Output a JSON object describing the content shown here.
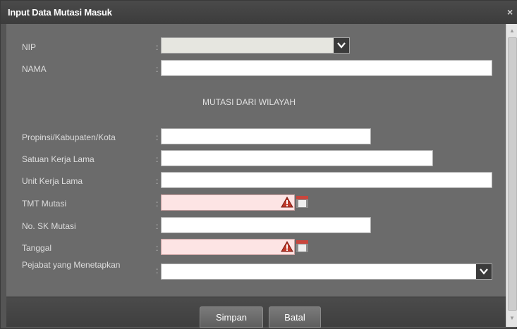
{
  "dialog": {
    "title": "Input Data Mutasi Masuk",
    "close_glyph": "×"
  },
  "form": {
    "colon": ":",
    "nip": {
      "label": "NIP",
      "value": ""
    },
    "nama": {
      "label": "NAMA",
      "value": ""
    },
    "section_title": "MUTASI DARI WILAYAH",
    "propinsi": {
      "label": "Propinsi/Kabupaten/Kota",
      "value": ""
    },
    "satuan_kerja": {
      "label": "Satuan Kerja Lama",
      "value": ""
    },
    "unit_kerja": {
      "label": "Unit Kerja Lama",
      "value": ""
    },
    "tmt_mutasi": {
      "label": "TMT Mutasi",
      "value": ""
    },
    "no_sk": {
      "label": "No. SK Mutasi",
      "value": ""
    },
    "tanggal": {
      "label": "Tanggal",
      "value": ""
    },
    "pejabat": {
      "label": "Pejabat yang Menetapkan",
      "value": ""
    }
  },
  "footer": {
    "save_label": "Simpan",
    "cancel_label": "Batal"
  },
  "icons": {
    "dropdown": "chevron-down-icon",
    "warning": "warning-icon",
    "calendar": "calendar-icon",
    "close": "close-icon"
  },
  "colors": {
    "invalid_field_bg": "#fde4e4",
    "warning_red": "#c0392b",
    "calendar_red": "#c9463d"
  }
}
